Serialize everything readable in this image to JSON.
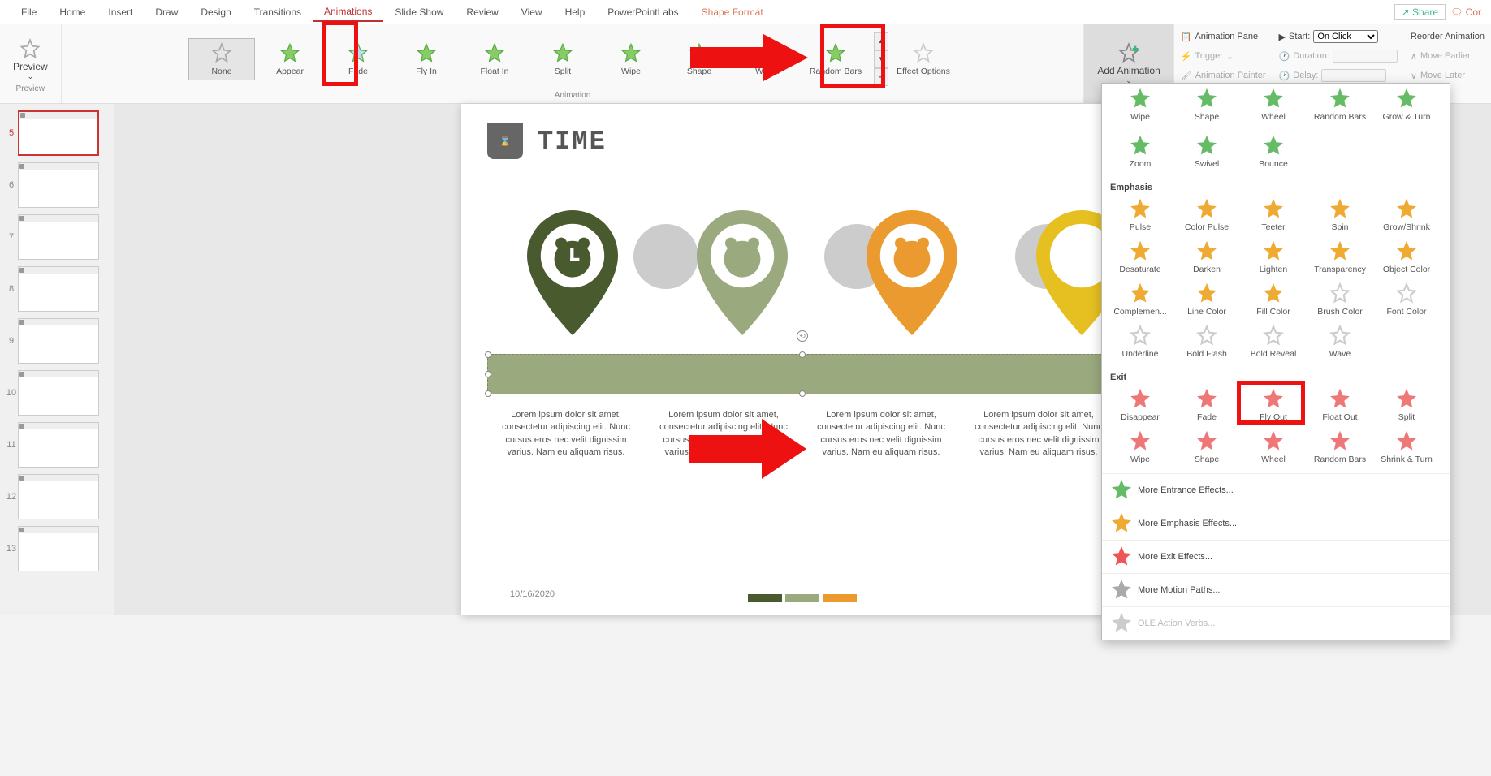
{
  "menubar": {
    "tabs": [
      "File",
      "Home",
      "Insert",
      "Draw",
      "Design",
      "Transitions",
      "Animations",
      "Slide Show",
      "Review",
      "View",
      "Help",
      "PowerPointLabs",
      "Shape Format"
    ],
    "active": "Animations",
    "share": "Share",
    "comments": "Cor"
  },
  "ribbon": {
    "preview": "Preview",
    "preview_group_label": "Preview",
    "anim_group_label": "Animation",
    "gallery": [
      "None",
      "Appear",
      "Fade",
      "Fly In",
      "Float In",
      "Split",
      "Wipe",
      "Shape",
      "Wheel",
      "Random Bars"
    ],
    "effect_options": "Effect Options",
    "add_animation": "Add Animation",
    "anim_pane": "Animation Pane",
    "trigger": "Trigger",
    "anim_painter": "Animation Painter",
    "start_label": "Start:",
    "start_value": "On Click",
    "duration_label": "Duration:",
    "delay_label": "Delay:",
    "reorder": "Reorder Animation",
    "move_earlier": "Move Earlier",
    "move_later": "Move Later"
  },
  "thumbs": {
    "start": 5,
    "count": 9,
    "active": 5
  },
  "slide": {
    "title": "TIME",
    "date": "10/16/2020",
    "lorem": "Lorem ipsum dolor sit amet, consectetur adipiscing elit. Nunc cursus eros nec velit dignissim varius. Nam eu aliquam risus."
  },
  "dropdown": {
    "row1": [
      "Wipe",
      "Shape",
      "Wheel",
      "Random Bars",
      "Grow & Turn"
    ],
    "row2": [
      "Zoom",
      "Swivel",
      "Bounce"
    ],
    "emphasis_label": "Emphasis",
    "emph": [
      "Pulse",
      "Color Pulse",
      "Teeter",
      "Spin",
      "Grow/Shrink",
      "Desaturate",
      "Darken",
      "Lighten",
      "Transparency",
      "Object Color",
      "Complemen...",
      "Line Color",
      "Fill Color",
      "Brush Color",
      "Font Color",
      "Underline",
      "Bold Flash",
      "Bold Reveal",
      "Wave"
    ],
    "exit_label": "Exit",
    "exit": [
      "Disappear",
      "Fade",
      "Fly Out",
      "Float Out",
      "Split",
      "Wipe",
      "Shape",
      "Wheel",
      "Random Bars",
      "Shrink & Turn"
    ],
    "more": [
      "More Entrance Effects...",
      "More Emphasis Effects...",
      "More Exit Effects...",
      "More Motion Paths...",
      "OLE Action Verbs..."
    ]
  }
}
